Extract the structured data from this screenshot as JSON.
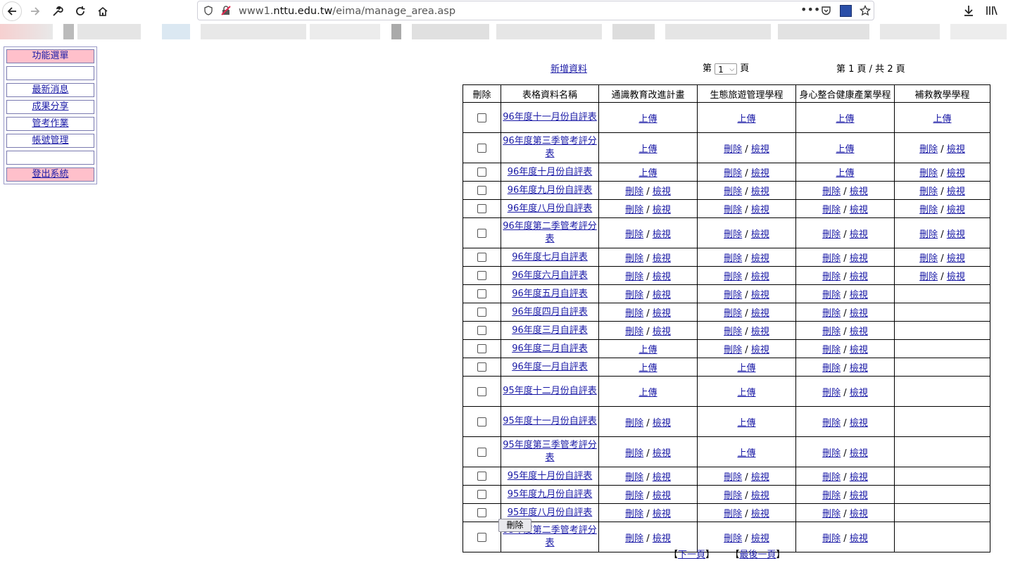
{
  "browser": {
    "url_prefix": "www1.",
    "url_domain": "nttu.edu.tw",
    "url_path": "/eima/manage_area.asp"
  },
  "sidebar": {
    "header": "功能選單",
    "items": [
      "",
      "最新消息",
      "成果分享",
      "管考作業",
      "帳號管理",
      ""
    ],
    "logout": "登出系統"
  },
  "topbar": {
    "add_link": "新增資料",
    "page_prefix": "第",
    "page_select": "1",
    "page_suffix": "頁",
    "page_info": "第 1 頁 / 共 2 頁"
  },
  "table": {
    "headers": [
      "刪除",
      "表格資料名稱",
      "通識教育改進計畫",
      "生態旅遊管理學程",
      "身心整合健康產業學程",
      "補救教學學程"
    ],
    "link_delete": "刪除",
    "link_view": "檢視",
    "link_upload": "上傳",
    "rows": [
      {
        "name": "96年度十一月份自評表",
        "cells": [
          "U",
          "U",
          "U",
          "U"
        ]
      },
      {
        "name": "96年度第三季管考評分表",
        "cells": [
          "U",
          "DV",
          "U",
          "DV"
        ]
      },
      {
        "name": "96年度十月份自評表",
        "cells": [
          "U",
          "DV",
          "U",
          "DV"
        ]
      },
      {
        "name": "96年度九月份自評表",
        "cells": [
          "DV",
          "DV",
          "DV",
          "DV"
        ]
      },
      {
        "name": "96年度八月份自評表",
        "cells": [
          "DV",
          "DV",
          "DV",
          "DV"
        ]
      },
      {
        "name": "96年度第二季管考評分表",
        "cells": [
          "DV",
          "DV",
          "DV",
          "DV"
        ]
      },
      {
        "name": "96年度七月自評表",
        "cells": [
          "DV",
          "DV",
          "DV",
          "DV"
        ]
      },
      {
        "name": "96年度六月自評表",
        "cells": [
          "DV",
          "DV",
          "DV",
          "DV"
        ]
      },
      {
        "name": "96年度五月自評表",
        "cells": [
          "DV",
          "DV",
          "DV",
          ""
        ]
      },
      {
        "name": "96年度四月自評表",
        "cells": [
          "DV",
          "DV",
          "DV",
          ""
        ]
      },
      {
        "name": "96年度三月自評表",
        "cells": [
          "DV",
          "DV",
          "DV",
          ""
        ]
      },
      {
        "name": "96年度二月自評表",
        "cells": [
          "U",
          "DV",
          "DV",
          ""
        ]
      },
      {
        "name": "96年度一月自評表",
        "cells": [
          "U",
          "U",
          "DV",
          ""
        ]
      },
      {
        "name": "95年度十二月份自評表",
        "cells": [
          "U",
          "U",
          "DV",
          ""
        ]
      },
      {
        "name": "95年度十一月份自評表",
        "cells": [
          "DV",
          "U",
          "DV",
          ""
        ]
      },
      {
        "name": "95年度第三季管考評分表",
        "cells": [
          "DV",
          "U",
          "DV",
          ""
        ]
      },
      {
        "name": "95年度十月份自評表",
        "cells": [
          "DV",
          "DV",
          "DV",
          ""
        ]
      },
      {
        "name": "95年度九月份自評表",
        "cells": [
          "DV",
          "DV",
          "DV",
          ""
        ]
      },
      {
        "name": "95年度八月份自評表",
        "cells": [
          "DV",
          "DV",
          "DV",
          ""
        ]
      },
      {
        "name": "95年度第二季管考評分表",
        "cells": [
          "DV",
          "DV",
          "DV",
          ""
        ]
      }
    ]
  },
  "footer": {
    "delete_button": "刪除",
    "next_link": "下一頁",
    "last_link": "最後一頁",
    "bracket_open": "【",
    "bracket_close": "】"
  }
}
